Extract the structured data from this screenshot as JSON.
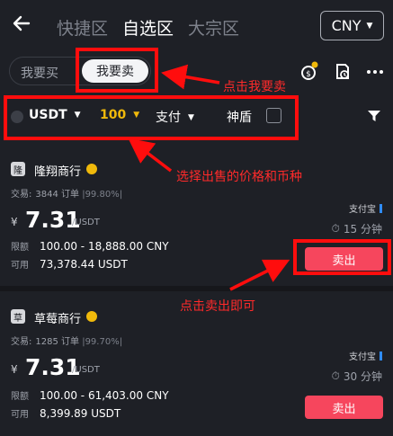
{
  "header": {
    "back_icon": "arrow-left-icon",
    "tabs": [
      {
        "label": "快捷区",
        "active": false
      },
      {
        "label": "自选区",
        "active": true
      },
      {
        "label": "大宗区",
        "active": false
      }
    ],
    "currency": "CNY"
  },
  "mode_toggle": {
    "buy_label": "我要买",
    "sell_label": "我要卖",
    "selected": "sell"
  },
  "toolbar_icons": [
    "coin-badge-icon",
    "order-history-icon",
    "more-icon"
  ],
  "filters": {
    "coin": "USDT",
    "amount": "100",
    "payment": "支付",
    "shield_label": "神盾",
    "shield_checked": false
  },
  "listings": [
    {
      "avatar": "隆",
      "merchant": "隆翔商行",
      "stats_label": "交易:",
      "trades": "3844 订单",
      "completion": "|99.80%|",
      "payment": "支付宝",
      "currency_symbol": "¥",
      "price": "7.31",
      "unit": "/USDT",
      "time": "15 分钟",
      "limit_label": "限额",
      "limit": "100.00 - 18,888.00 CNY",
      "available_label": "可用",
      "available": "73,378.44 USDT",
      "action": "卖出"
    },
    {
      "avatar": "草",
      "merchant": "草莓商行",
      "stats_label": "交易:",
      "trades": "1285 订单",
      "completion": "|99.70%|",
      "payment": "支付宝",
      "currency_symbol": "¥",
      "price": "7.31",
      "unit": "/USDT",
      "time": "30 分钟",
      "limit_label": "限额",
      "limit": "100.00 - 61,403.00 CNY",
      "available_label": "可用",
      "available": "8,399.89 USDT",
      "action": "卖出"
    }
  ],
  "annotations": {
    "color": "#ff0d0d",
    "note_sell_tab": "点击我要卖",
    "note_filters": "选择出售的价格和币种",
    "note_sell_button": "点击卖出即可"
  }
}
